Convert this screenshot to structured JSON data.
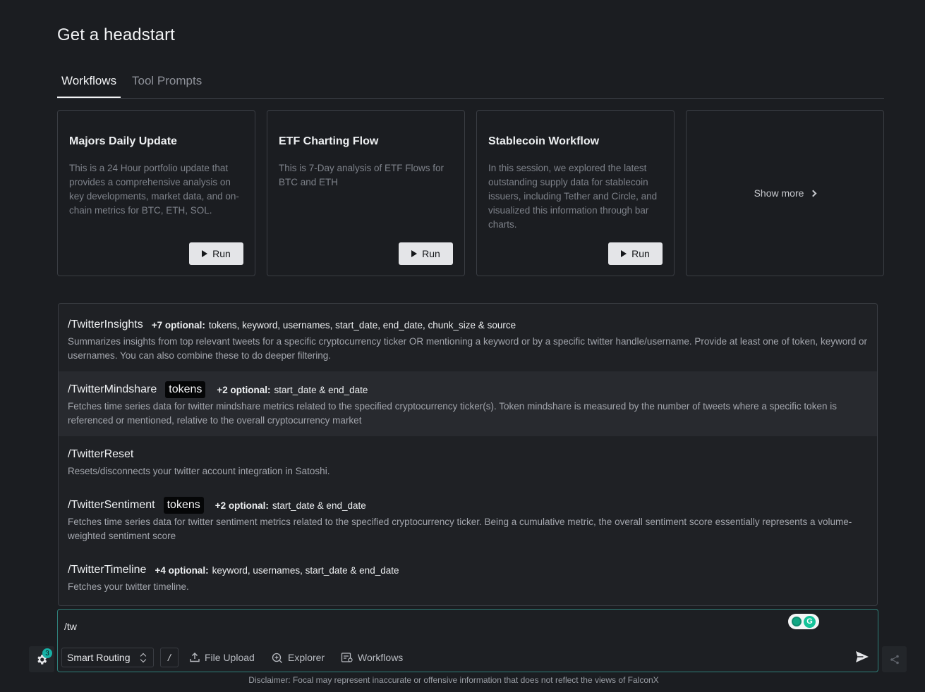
{
  "page_title": "Get a headstart",
  "tabs": [
    {
      "label": "Workflows",
      "active": true
    },
    {
      "label": "Tool Prompts",
      "active": false
    }
  ],
  "cards": [
    {
      "title": "Majors Daily Update",
      "description": "This is a 24 Hour portfolio update that provides a comprehensive analysis on key developments, market data, and on-chain metrics for BTC, ETH, SOL.",
      "button": "Run"
    },
    {
      "title": "ETF Charting Flow",
      "description": "This is 7-Day analysis of ETF Flows for BTC and ETH",
      "button": "Run"
    },
    {
      "title": "Stablecoin Workflow",
      "description": "In this session, we explored the latest outstanding supply data for stablecoin issuers, including Tether and Circle, and visualized this information through bar charts.",
      "button": "Run"
    }
  ],
  "show_more": "Show more",
  "commands": [
    {
      "name": "/TwitterInsights",
      "token": "",
      "optional_label": "+7 optional:",
      "optional_values": "tokens, keyword, usernames, start_date, end_date, chunk_size & source",
      "description": "Summarizes insights from top relevant tweets for a specific cryptocurrency ticker OR mentioning a keyword or by a specific twitter handle/username. Provide at least one of token, keyword or usernames. You can also combine these to do deeper filtering."
    },
    {
      "name": "/TwitterMindshare",
      "token": "tokens",
      "optional_label": "+2 optional:",
      "optional_values": "start_date & end_date",
      "description": "Fetches time series data for twitter mindshare metrics related to the specified cryptocurrency ticker(s). Token mindshare is measured by the number of tweets where a specific token is referenced or mentioned, relative to the overall cryptocurrency market"
    },
    {
      "name": "/TwitterReset",
      "token": "",
      "optional_label": "",
      "optional_values": "",
      "description": "Resets/disconnects your twitter account integration in Satoshi."
    },
    {
      "name": "/TwitterSentiment",
      "token": "tokens",
      "optional_label": "+2 optional:",
      "optional_values": "start_date & end_date",
      "description": "Fetches time series data for twitter sentiment metrics related to the specified cryptocurrency ticker. Being a cumulative metric, the overall sentiment score essentially represents a volume-weighted sentiment score"
    },
    {
      "name": "/TwitterTimeline",
      "token": "",
      "optional_label": "+4 optional:",
      "optional_values": "keyword, usernames, start_date & end_date",
      "description": "Fetches your twitter timeline."
    }
  ],
  "input": {
    "value": "/tw"
  },
  "toolbar": {
    "routing": "Smart Routing",
    "slash": "/",
    "file_upload": "File Upload",
    "explorer": "Explorer",
    "workflows": "Workflows"
  },
  "settings_badge": "3",
  "disclaimer": "Disclaimer: Focal may represent inaccurate or offensive information that does not reflect the views of FalconX",
  "colors": {
    "accent": "#2f7f79",
    "badge": "#17b1a6",
    "background": "#1b1d21"
  }
}
